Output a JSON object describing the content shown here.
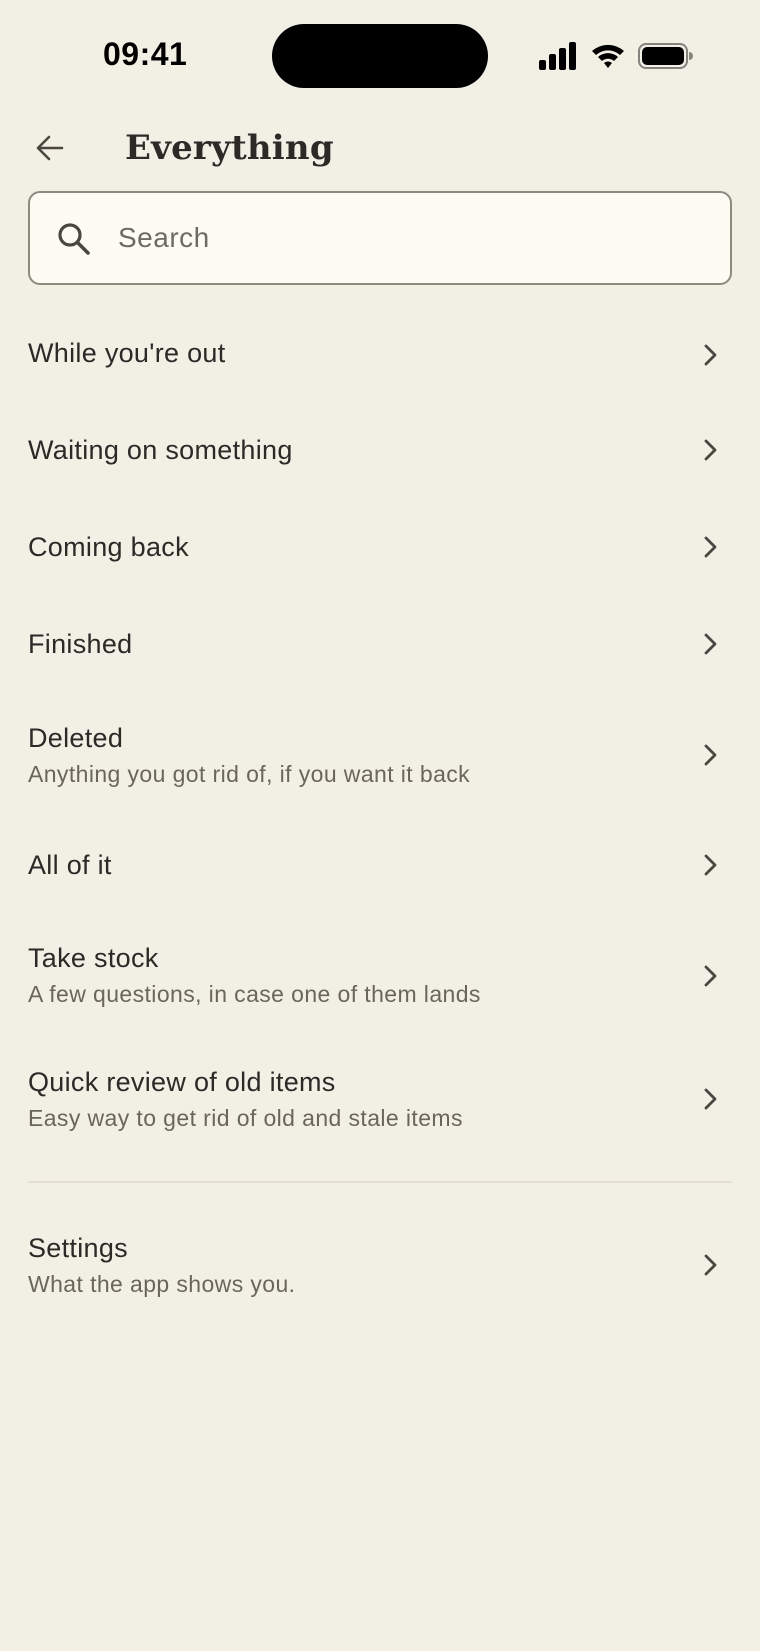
{
  "status_bar": {
    "time": "09:41"
  },
  "header": {
    "title": "Everything"
  },
  "search": {
    "placeholder": "Search",
    "value": ""
  },
  "menu": {
    "items": [
      {
        "label": "While you're out",
        "sublabel": ""
      },
      {
        "label": "Waiting on something",
        "sublabel": ""
      },
      {
        "label": "Coming back",
        "sublabel": ""
      },
      {
        "label": "Finished",
        "sublabel": ""
      },
      {
        "label": "Deleted",
        "sublabel": "Anything you got rid of, if you want it back"
      },
      {
        "label": "All of it",
        "sublabel": ""
      },
      {
        "label": "Take stock",
        "sublabel": "A few questions, in case one of them lands"
      },
      {
        "label": "Quick review of old items",
        "sublabel": "Easy way to get rid of old and stale items"
      }
    ],
    "settings": {
      "label": "Settings",
      "sublabel": "What the app shows you."
    }
  },
  "icons": {
    "back": "arrow-left-icon",
    "search": "search-icon",
    "chevron": "chevron-right-icon",
    "signal": "cellular-signal-icon",
    "wifi": "wifi-icon",
    "battery": "battery-icon"
  },
  "colors": {
    "background": "#f2efe5",
    "search_background": "#fcfbf4",
    "search_border": "#8f8a80",
    "text_primary": "#2b2a27",
    "text_secondary": "#6a665e"
  }
}
